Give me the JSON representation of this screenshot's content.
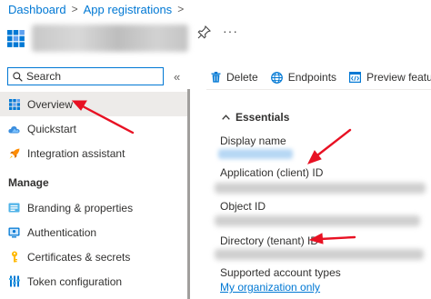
{
  "breadcrumb": {
    "items": [
      "Dashboard",
      "App registrations"
    ],
    "separator": ">"
  },
  "header": {
    "more_label": "···"
  },
  "search": {
    "value": "",
    "placeholder": "Search"
  },
  "collapse_label": "«",
  "nav": {
    "items": [
      {
        "label": "Overview",
        "icon": "grid-icon",
        "selected": true
      },
      {
        "label": "Quickstart",
        "icon": "cloud-icon"
      },
      {
        "label": "Integration assistant",
        "icon": "rocket-icon"
      }
    ],
    "manage_header": "Manage",
    "manage_items": [
      {
        "label": "Branding & properties",
        "icon": "branding-icon"
      },
      {
        "label": "Authentication",
        "icon": "authentication-icon"
      },
      {
        "label": "Certificates & secrets",
        "icon": "key-icon"
      },
      {
        "label": "Token configuration",
        "icon": "token-config-icon"
      }
    ]
  },
  "toolbar": {
    "delete_label": "Delete",
    "endpoints_label": "Endpoints",
    "preview_label": "Preview features"
  },
  "essentials": {
    "header": "Essentials",
    "fields": [
      {
        "label": "Display name"
      },
      {
        "label": "Application (client) ID"
      },
      {
        "label": "Object ID"
      },
      {
        "label": "Directory (tenant) ID"
      },
      {
        "label": "Supported account types",
        "link": "My organization only"
      }
    ]
  },
  "colors": {
    "accent": "#0078d4",
    "annotation_arrow": "#e81123",
    "selected_bg": "#edebe9"
  }
}
